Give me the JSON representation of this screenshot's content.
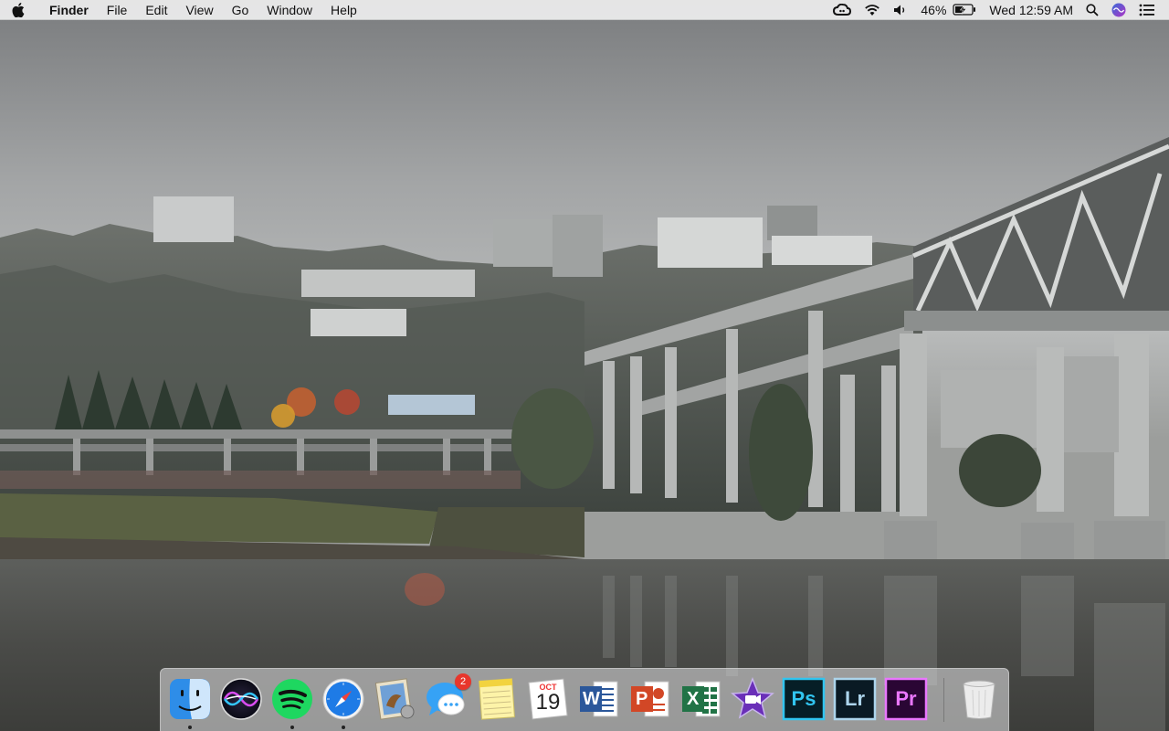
{
  "menubar": {
    "app_name": "Finder",
    "menus": [
      "File",
      "Edit",
      "View",
      "Go",
      "Window",
      "Help"
    ],
    "battery_percent": "46%",
    "clock": "Wed 12:59 AM"
  },
  "status_icons": [
    "creative-cloud-icon",
    "wifi-icon",
    "volume-icon",
    "battery-charging-icon",
    "spotlight-search-icon",
    "siri-icon",
    "notification-center-icon"
  ],
  "dock": {
    "apps": [
      {
        "name": "Finder",
        "icon": "finder-icon",
        "running": true
      },
      {
        "name": "Siri",
        "icon": "siri-icon",
        "running": false
      },
      {
        "name": "Spotify",
        "icon": "spotify-icon",
        "running": true
      },
      {
        "name": "Safari",
        "icon": "safari-icon",
        "running": true
      },
      {
        "name": "Mail",
        "icon": "mail-icon",
        "running": false
      },
      {
        "name": "Messages",
        "icon": "messages-icon",
        "running": false,
        "badge": "2"
      },
      {
        "name": "Notes",
        "icon": "notes-icon",
        "running": false
      },
      {
        "name": "Calendar",
        "icon": "calendar-icon",
        "running": false,
        "month": "OCT",
        "day": "19"
      },
      {
        "name": "Microsoft Word",
        "icon": "word-icon",
        "running": false,
        "letter": "W"
      },
      {
        "name": "Microsoft PowerPoint",
        "icon": "powerpoint-icon",
        "running": false,
        "letter": "P"
      },
      {
        "name": "Microsoft Excel",
        "icon": "excel-icon",
        "running": false,
        "letter": "X"
      },
      {
        "name": "iMovie",
        "icon": "imovie-icon",
        "running": false
      },
      {
        "name": "Adobe Photoshop",
        "icon": "photoshop-icon",
        "running": false,
        "label": "Ps"
      },
      {
        "name": "Adobe Lightroom",
        "icon": "lightroom-icon",
        "running": false,
        "label": "Lr"
      },
      {
        "name": "Adobe Premiere Pro",
        "icon": "premiere-icon",
        "running": false,
        "label": "Pr"
      },
      {
        "name": "Trash",
        "icon": "trash-icon",
        "running": false
      }
    ]
  },
  "colors": {
    "menubar_bg": "#ececec",
    "badge_red": "#e8362c",
    "photoshop_accent": "#31c5f0",
    "lightroom_accent": "#add5ec",
    "premiere_accent": "#ea77ff"
  }
}
